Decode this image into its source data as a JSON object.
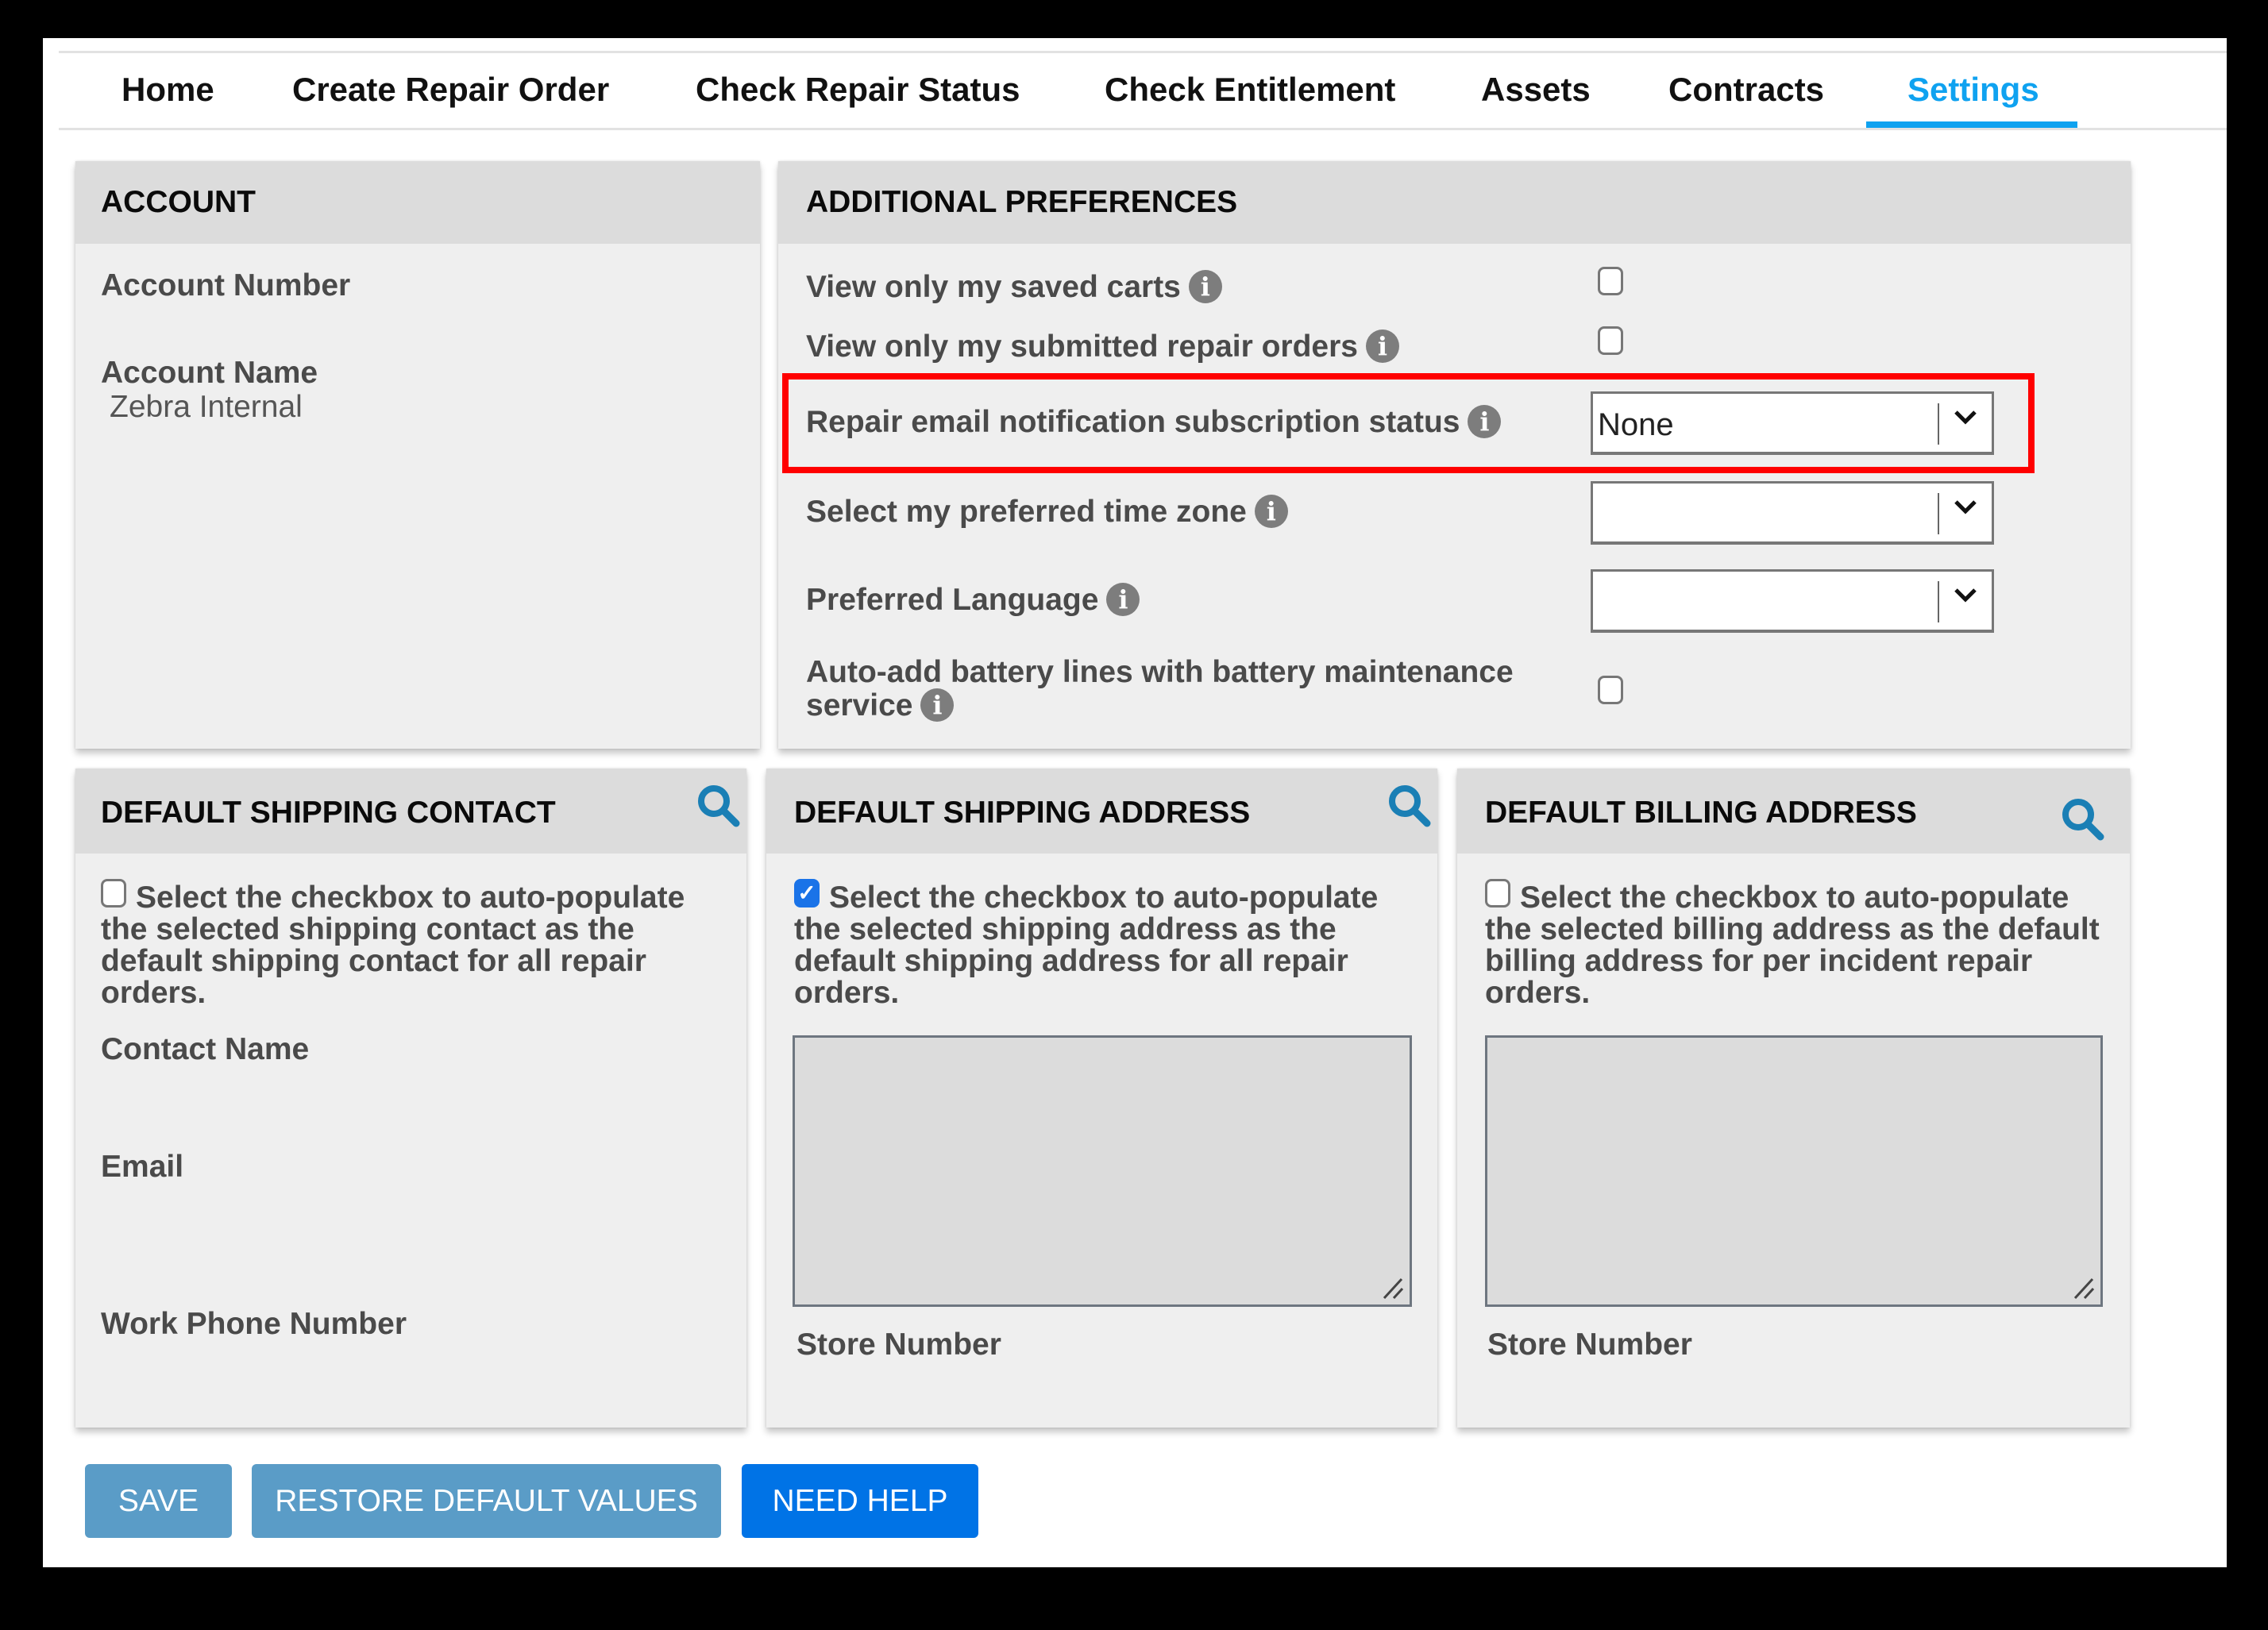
{
  "nav": {
    "tabs": [
      {
        "label": "Home",
        "active": false
      },
      {
        "label": "Create Repair Order",
        "active": false
      },
      {
        "label": "Check Repair Status",
        "active": false
      },
      {
        "label": "Check Entitlement",
        "active": false
      },
      {
        "label": "Assets",
        "active": false
      },
      {
        "label": "Contracts",
        "active": false
      },
      {
        "label": "Settings",
        "active": true
      }
    ],
    "accent_color": "#0fa2f0"
  },
  "account": {
    "title": "ACCOUNT",
    "account_number_label": "Account Number",
    "account_number_value": "",
    "account_name_label": "Account Name",
    "account_name_value": "Zebra Internal"
  },
  "preferences": {
    "title": "ADDITIONAL PREFERENCES",
    "saved_carts_label": "View only my saved carts",
    "saved_carts_checked": false,
    "submitted_orders_label": "View only my submitted repair orders",
    "submitted_orders_checked": false,
    "email_subscription_label": "Repair email notification subscription status",
    "email_subscription_value": "None",
    "time_zone_label": "Select my preferred time zone",
    "time_zone_value": "",
    "language_label": "Preferred Language",
    "language_value": "",
    "battery_label_line1": "Auto-add battery lines with battery maintenance",
    "battery_label_line2": "service",
    "battery_checked": false,
    "info_icon_glyph": "i",
    "highlight_color": "#ff0000"
  },
  "shipping_contact": {
    "title": "DEFAULT SHIPPING CONTACT",
    "checkbox_checked": false,
    "checkbox_text": "Select the checkbox to auto-populate the selected shipping contact as the default shipping contact for all repair orders.",
    "contact_name_label": "Contact Name",
    "email_label": "Email",
    "work_phone_label": "Work Phone Number"
  },
  "shipping_address": {
    "title": "DEFAULT SHIPPING ADDRESS",
    "checkbox_checked": true,
    "checkbox_text": "Select the checkbox to auto-populate the selected shipping address as the default shipping address for all repair orders.",
    "address_value": "",
    "store_number_label": "Store Number"
  },
  "billing_address": {
    "title": "DEFAULT BILLING ADDRESS",
    "checkbox_checked": false,
    "checkbox_text": "Select the checkbox to auto-populate the selected billing address as the default billing address for per incident repair orders.",
    "address_value": "",
    "store_number_label": "Store Number"
  },
  "actions": {
    "save_label": "SAVE",
    "restore_label": "RESTORE DEFAULT VALUES",
    "help_label": "NEED HELP",
    "secondary_color": "#5a9cc7",
    "primary_color": "#0073e6"
  },
  "icons": {
    "search": "search-icon",
    "info": "info-icon",
    "dropdown": "chevron-down-icon",
    "resize": "resize-grip-icon"
  }
}
